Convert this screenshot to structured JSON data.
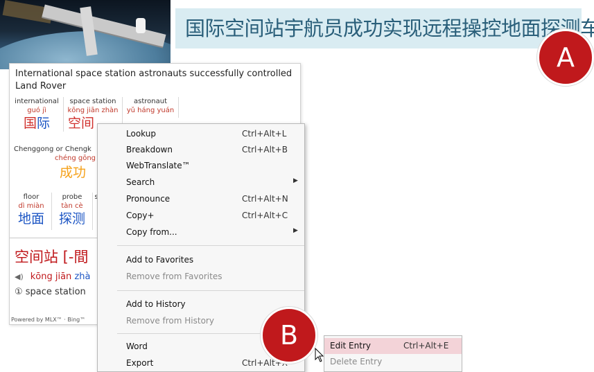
{
  "banner": {
    "text": "国际空间站宇航员成功实现远程操控地面探测车"
  },
  "markers": {
    "a": "A",
    "b": "B"
  },
  "popup": {
    "sentence": "International space station astronauts successfully controlled Land Rover",
    "words_row1": [
      {
        "en": "international",
        "py": "guó jì",
        "hz1": "国",
        "hz2": "际"
      },
      {
        "en": "space station",
        "py": "kōng jiān zhàn",
        "hz": "空间"
      },
      {
        "en": "astronaut",
        "py": "yǔ háng yuán"
      }
    ],
    "cheng": {
      "en": "Chenggong or Chengk",
      "py": "chéng gōng",
      "hz": "成功"
    },
    "words_row3": [
      {
        "en": "floor",
        "py": "dì miàn",
        "hz": "地面"
      },
      {
        "en": "probe",
        "py": "tàn cè",
        "hz": "探测"
      },
      {
        "en": "s"
      }
    ],
    "dict": {
      "headword": "空间站 [-間",
      "speaker": "◀)",
      "pinyin1": "kōng jiān",
      "pinyin2": "zhà",
      "definition": "① space station"
    },
    "powered": "Powered by MLX™ · Bing™"
  },
  "menu": {
    "items": [
      {
        "label": "Lookup",
        "shortcut": "Ctrl+Alt+L"
      },
      {
        "label": "Breakdown",
        "shortcut": "Ctrl+Alt+B"
      },
      {
        "label": "WebTranslate™",
        "shortcut": ""
      },
      {
        "label": "Search",
        "shortcut": "",
        "arrow": "▶"
      },
      {
        "label": "Pronounce",
        "shortcut": "Ctrl+Alt+N"
      },
      {
        "label": "Copy+",
        "shortcut": "Ctrl+Alt+C"
      },
      {
        "label": "Copy from...",
        "shortcut": "",
        "arrow": "▶"
      },
      {
        "label": "Add to Favorites",
        "shortcut": ""
      },
      {
        "label": "Remove from Favorites",
        "shortcut": "",
        "disabled": true
      },
      {
        "label": "Add to History",
        "shortcut": ""
      },
      {
        "label": "Remove from History",
        "shortcut": "",
        "disabled": true
      },
      {
        "label": "Word",
        "shortcut": ""
      },
      {
        "label": "Export",
        "shortcut": "Ctrl+Alt+X"
      }
    ]
  },
  "submenu": {
    "items": [
      {
        "label": "Edit Entry",
        "shortcut": "Ctrl+Alt+E",
        "highlighted": true
      },
      {
        "label": "Delete Entry",
        "shortcut": "",
        "disabled": true
      }
    ]
  }
}
